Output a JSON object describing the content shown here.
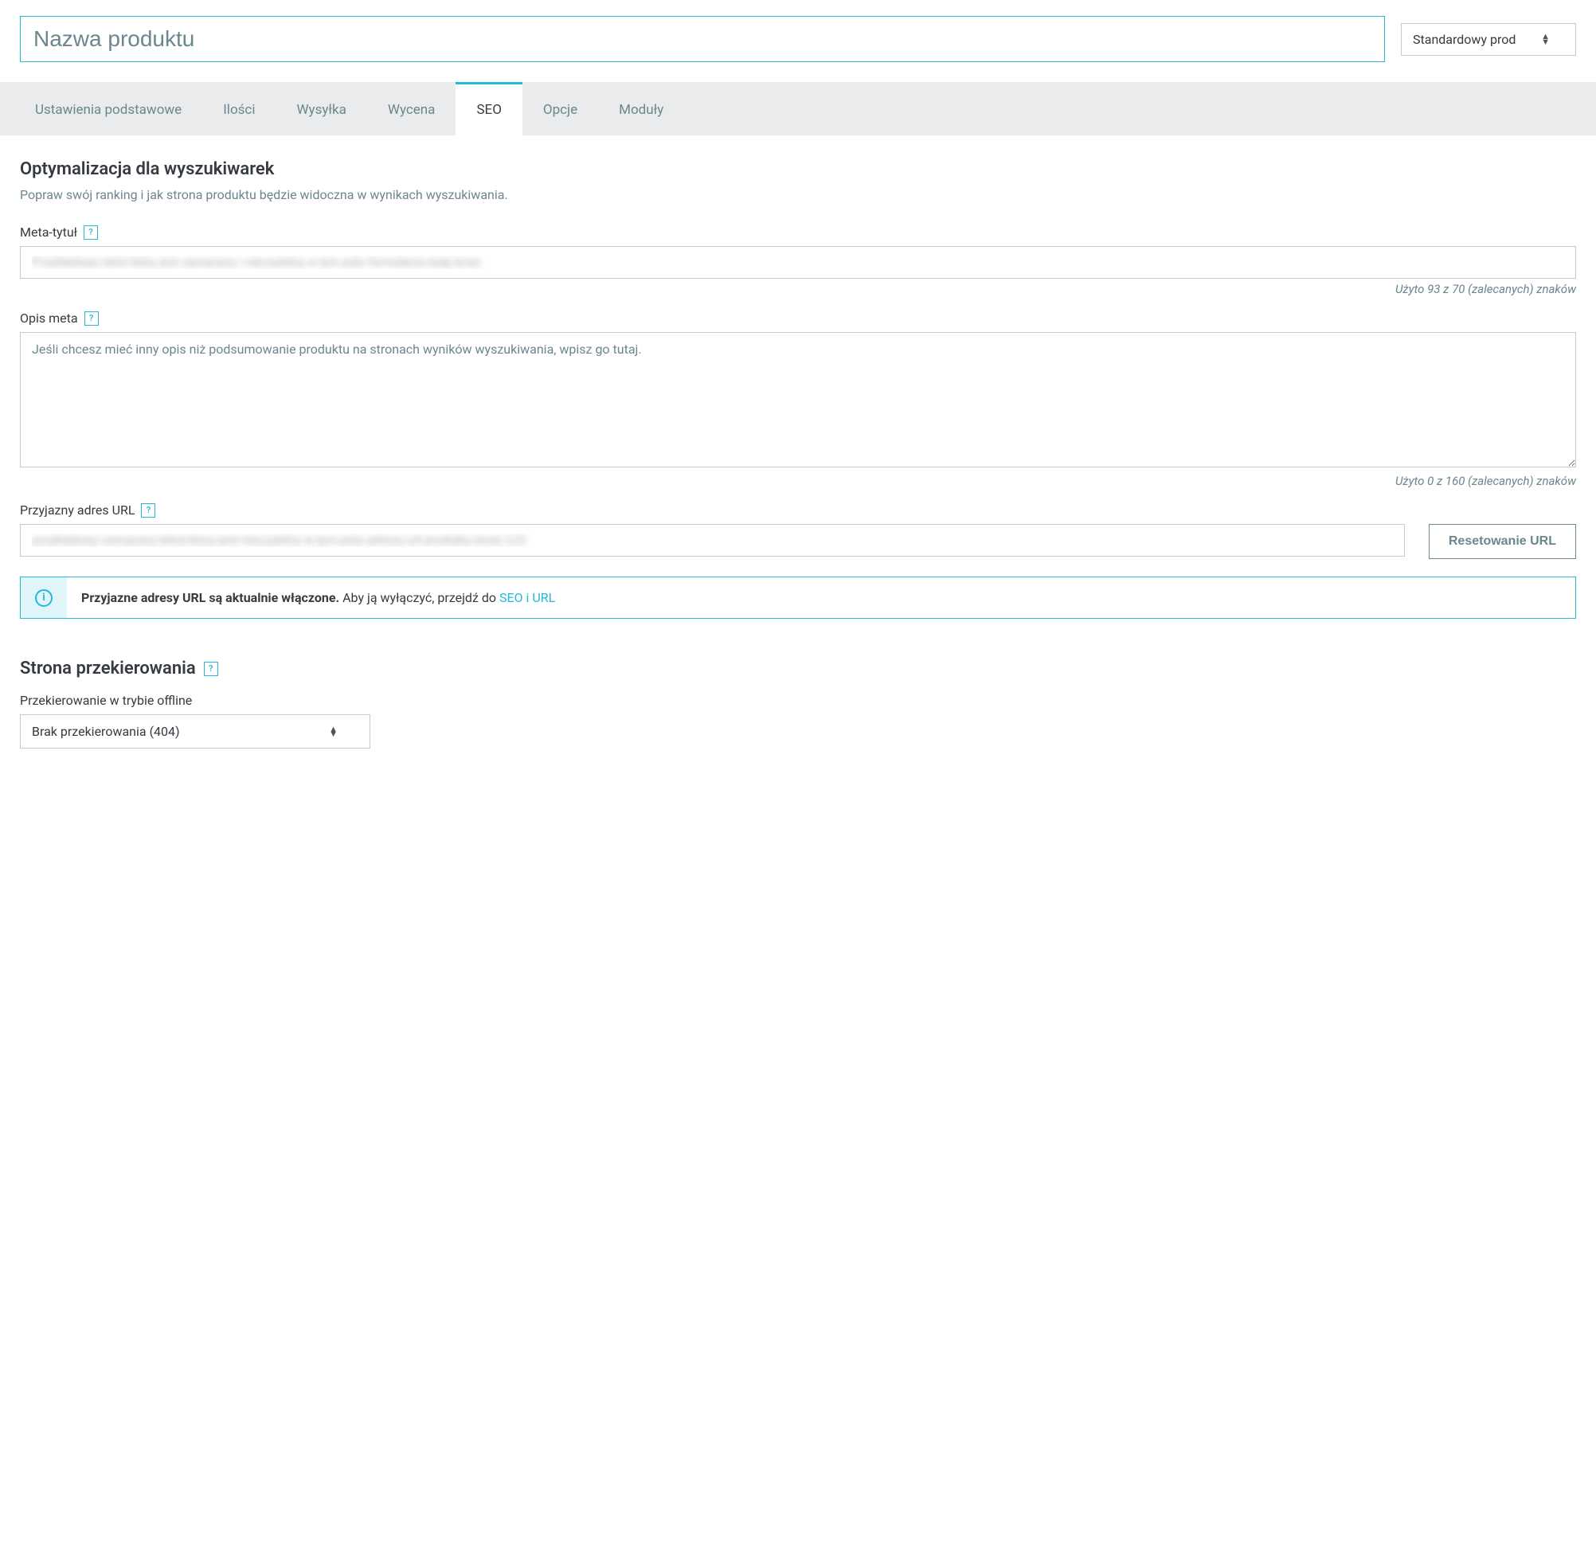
{
  "header": {
    "product_name_placeholder": "Nazwa produktu",
    "product_type_selected": "Standardowy prod"
  },
  "tabs": {
    "items": [
      {
        "label": "Ustawienia podstawowe",
        "active": false
      },
      {
        "label": "Ilości",
        "active": false
      },
      {
        "label": "Wysyłka",
        "active": false
      },
      {
        "label": "Wycena",
        "active": false
      },
      {
        "label": "SEO",
        "active": true
      },
      {
        "label": "Opcje",
        "active": false
      },
      {
        "label": "Moduły",
        "active": false
      }
    ]
  },
  "seo": {
    "section_title": "Optymalizacja dla wyszukiwarek",
    "section_desc": "Popraw swój ranking i jak strona produktu będzie widoczna w wynikach wyszukiwania.",
    "meta_title_label": "Meta-tytuł",
    "meta_title_value": "Przykładowy tekst który jest zamazany i nieczytelny w tym polu formularza tutaj teraz",
    "meta_title_counter": "Użyto 93 z 70 (zalecanych) znaków",
    "meta_desc_label": "Opis meta",
    "meta_desc_placeholder": "Jeśli chcesz mieć inny opis niż podsumowanie produktu na stronach wyników wyszukiwania, wpisz go tutaj.",
    "meta_desc_counter": "Użyto 0 z 160 (zalecanych) znaków",
    "friendly_url_label": "Przyjazny adres URL",
    "friendly_url_value": "przykladowy-zamazany-tekst-ktory-jest-nieczytelny-w-tym-polu-adresu-url-produktu-teraz-123",
    "reset_url_label": "Resetowanie URL",
    "info_strong": "Przyjazne adresy URL są aktualnie włączone.",
    "info_rest": " Aby ją wyłączyć, przejdź do ",
    "info_link": "SEO i URL",
    "redirect_section_title": "Strona przekierowania",
    "redirect_offline_label": "Przekierowanie w trybie offline",
    "redirect_selected": "Brak przekierowania (404)"
  }
}
